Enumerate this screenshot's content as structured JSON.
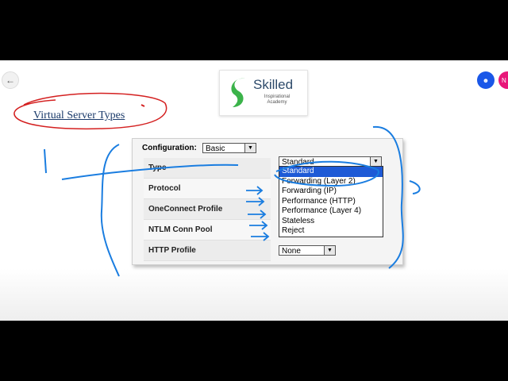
{
  "slide": {
    "title": "Virtual Server Types"
  },
  "logo": {
    "name": "Skilled",
    "tagline_line1": "Inspirational",
    "tagline_line2": "Academy",
    "brand_color": "#2d4a6a",
    "accent_color": "#3bb34a"
  },
  "nav": {
    "back_icon": "arrow-left-icon"
  },
  "avatars": {
    "blue_icon": "user-icon",
    "pink_initial": "N"
  },
  "panel": {
    "config_label": "Configuration:",
    "config_value": "Basic",
    "type_value": "Standard",
    "http_profile_value": "None",
    "rows": [
      {
        "label": "Type"
      },
      {
        "label": "Protocol"
      },
      {
        "label": "OneConnect Profile"
      },
      {
        "label": "NTLM Conn Pool"
      },
      {
        "label": "HTTP Profile"
      }
    ],
    "type_options": [
      "Standard",
      "Forwarding (Layer 2)",
      "Forwarding (IP)",
      "Performance (HTTP)",
      "Performance (Layer 4)",
      "Stateless",
      "Reject"
    ],
    "selected_index": 0,
    "selection_color": "#1e5ad6"
  },
  "annotation": {
    "ink_color_red": "#d42020",
    "ink_color_blue": "#1a7de0"
  }
}
